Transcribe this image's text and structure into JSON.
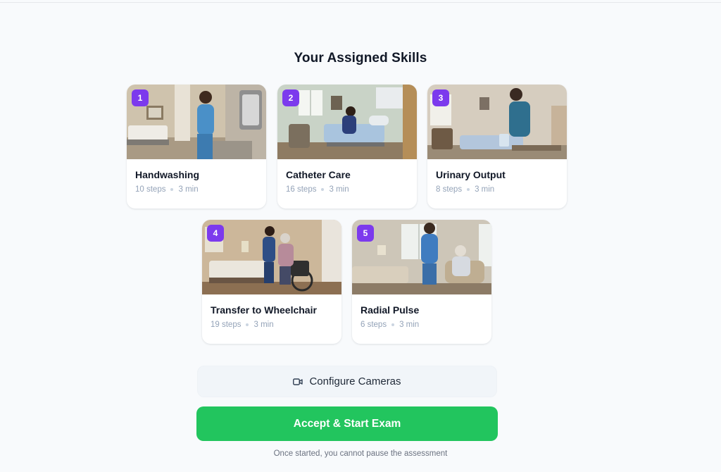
{
  "page": {
    "title": "Your Assigned Skills"
  },
  "skills": [
    {
      "number": "1",
      "name": "Handwashing",
      "steps": "10 steps",
      "time": "3 min"
    },
    {
      "number": "2",
      "name": "Catheter Care",
      "steps": "16 steps",
      "time": "3 min"
    },
    {
      "number": "3",
      "name": "Urinary Output",
      "steps": "8 steps",
      "time": "3 min"
    },
    {
      "number": "4",
      "name": "Transfer to Wheelchair",
      "steps": "19 steps",
      "time": "3 min"
    },
    {
      "number": "5",
      "name": "Radial Pulse",
      "steps": "6 steps",
      "time": "3 min"
    }
  ],
  "actions": {
    "configure_label": "Configure Cameras",
    "configure_icon": "video-camera-icon",
    "start_label": "Accept & Start Exam",
    "note": "Once started, you cannot pause the assessment"
  },
  "colors": {
    "badge": "#7c3aed",
    "start": "#22c55e",
    "background": "#f8fafc"
  }
}
